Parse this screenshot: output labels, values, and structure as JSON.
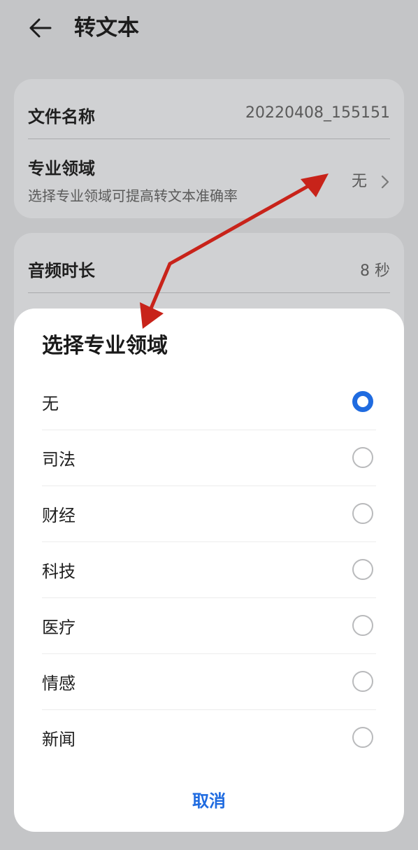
{
  "header": {
    "title": "转文本",
    "back_icon": "arrow-left-icon"
  },
  "file": {
    "label": "文件名称",
    "value": "20220408_155151"
  },
  "domain_row": {
    "label": "专业领域",
    "sub": "选择专业领域可提高转文本准确率",
    "value": "无"
  },
  "duration": {
    "label": "音频时长",
    "value": "8 秒"
  },
  "sheet": {
    "title": "选择专业领域",
    "options": [
      {
        "label": "无",
        "selected": true
      },
      {
        "label": "司法",
        "selected": false
      },
      {
        "label": "财经",
        "selected": false
      },
      {
        "label": "科技",
        "selected": false
      },
      {
        "label": "医疗",
        "selected": false
      },
      {
        "label": "情感",
        "selected": false
      },
      {
        "label": "新闻",
        "selected": false
      }
    ],
    "cancel": "取消"
  },
  "colors": {
    "accent": "#1f6be0",
    "annotation": "#c8231a"
  }
}
